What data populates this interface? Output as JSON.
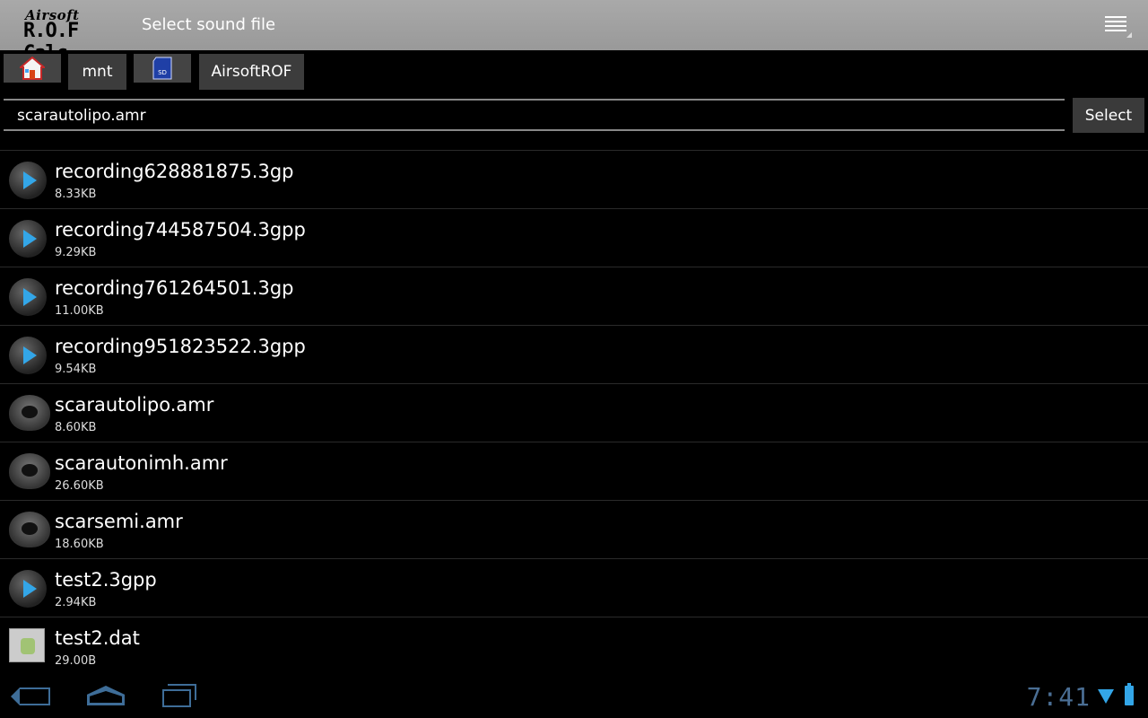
{
  "app": {
    "logo_line1": "Airsoft",
    "logo_line2": "R.O.F Calc",
    "title": "Select sound file"
  },
  "breadcrumb": [
    {
      "label": "",
      "icon": "home-icon"
    },
    {
      "label": "mnt",
      "icon": ""
    },
    {
      "label": "",
      "icon": "sd-card-icon"
    },
    {
      "label": "AirsoftROF",
      "icon": ""
    }
  ],
  "filename": {
    "value": "scarautolipo.amr"
  },
  "select_label": "Select",
  "files": [
    {
      "name": "recording628881875.3gp",
      "size": "8.33KB",
      "icon": "play-icon"
    },
    {
      "name": "recording744587504.3gpp",
      "size": "9.29KB",
      "icon": "play-icon"
    },
    {
      "name": "recording761264501.3gp",
      "size": "11.00KB",
      "icon": "play-icon"
    },
    {
      "name": "recording951823522.3gpp",
      "size": "9.54KB",
      "icon": "play-icon"
    },
    {
      "name": "scarautolipo.amr",
      "size": "8.60KB",
      "icon": "sound-file-icon"
    },
    {
      "name": "scarautonimh.amr",
      "size": "26.60KB",
      "icon": "sound-file-icon"
    },
    {
      "name": "scarsemi.amr",
      "size": "18.60KB",
      "icon": "sound-file-icon"
    },
    {
      "name": "test2.3gpp",
      "size": "2.94KB",
      "icon": "play-icon"
    },
    {
      "name": "test2.dat",
      "size": "29.00B",
      "icon": "generic-file-icon"
    }
  ],
  "status": {
    "clock": "7:41"
  },
  "colors": {
    "accent": "#33a6e8",
    "actionbar": "#a0a0a0",
    "nav": "#3e6d98"
  }
}
